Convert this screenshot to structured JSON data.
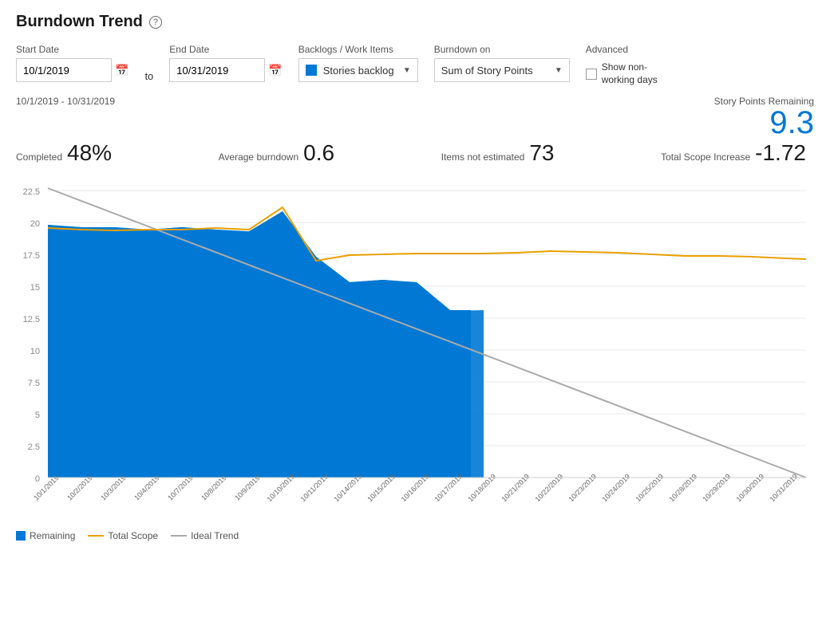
{
  "title": "Burndown Trend",
  "help_icon": "?",
  "filters": {
    "start_date_label": "Start Date",
    "start_date_value": "10/1/2019",
    "to_label": "to",
    "end_date_label": "End Date",
    "end_date_value": "10/31/2019",
    "backlogs_label": "Backlogs / Work Items",
    "backlogs_value": "Stories backlog",
    "burndown_label": "Burndown on",
    "burndown_value": "Sum of Story Points",
    "advanced_label": "Advanced",
    "show_nonworking_label": "Show non-working days"
  },
  "date_range": "10/1/2019 - 10/31/2019",
  "stats": {
    "completed_label": "Completed",
    "completed_value": "48%",
    "average_label": "Average burndown",
    "average_value": "0.6",
    "items_not_estimated_label": "Items not estimated",
    "items_not_estimated_value": "73",
    "total_scope_label": "Total Scope Increase",
    "total_scope_value": "-1.72",
    "story_points_label": "Story Points Remaining",
    "story_points_value": "9.3"
  },
  "legend": {
    "remaining_label": "Remaining",
    "total_scope_label": "Total Scope",
    "ideal_trend_label": "Ideal Trend"
  },
  "colors": {
    "remaining": "#0078d4",
    "total_scope": "#e8a000",
    "ideal_trend": "#aaa",
    "accent": "#0078d4"
  }
}
